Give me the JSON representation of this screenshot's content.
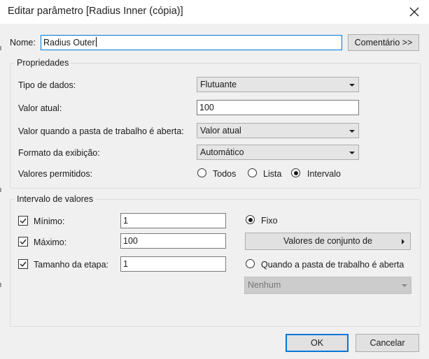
{
  "window": {
    "title": "Editar parâmetro [Radius Inner (cópia)]",
    "close_icon": "close-icon"
  },
  "name_row": {
    "label": "Nome:",
    "value": "Radius Outer",
    "comment_button": "Comentário >>"
  },
  "properties": {
    "group_title": "Propriedades",
    "data_type_label": "Tipo de dados:",
    "data_type_value": "Flutuante",
    "current_value_label": "Valor atual:",
    "current_value": "100",
    "on_open_label": "Valor quando a pasta de trabalho é aberta:",
    "on_open_value": "Valor atual",
    "display_format_label": "Formato da exibição:",
    "display_format_value": "Automático",
    "allowed_label": "Valores permitidos:",
    "allowed_options": [
      "Todos",
      "Lista",
      "Intervalo"
    ],
    "allowed_selected": "Intervalo"
  },
  "range": {
    "group_title": "Intervalo de valores",
    "min_label": "Mínimo:",
    "min_checked": true,
    "min_value": "1",
    "max_label": "Máximo:",
    "max_checked": true,
    "max_value": "100",
    "step_label": "Tamanho da etapa:",
    "step_checked": true,
    "step_value": "1",
    "fixed_label": "Fixo",
    "fixed_selected": true,
    "set_values_button": "Valores de conjunto de",
    "on_open_label": "Quando a pasta de trabalho é aberta",
    "on_open_selected": false,
    "none_value": "Nenhum"
  },
  "footer": {
    "ok": "OK",
    "cancel": "Cancelar"
  }
}
